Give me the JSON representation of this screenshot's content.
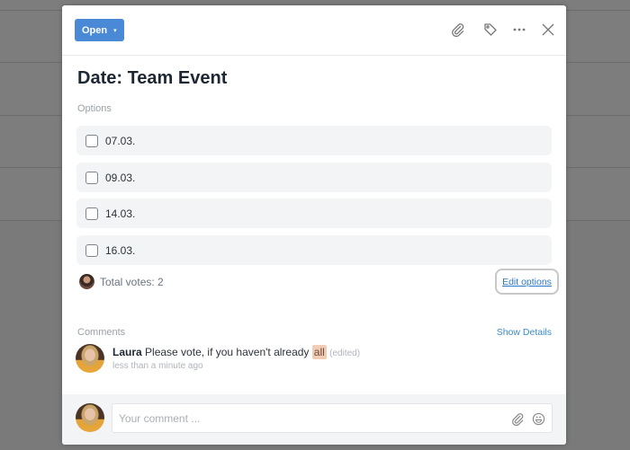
{
  "header": {
    "status_label": "Open",
    "status_caret": "▾",
    "status_color": "#4a89d6",
    "actions": [
      {
        "name": "attachment-icon"
      },
      {
        "name": "tag-icon"
      },
      {
        "name": "more-icon"
      },
      {
        "name": "close-icon"
      }
    ]
  },
  "title": "Date: Team Event",
  "poll": {
    "options_label": "Options",
    "options": [
      {
        "label": "07.03.",
        "checked": false
      },
      {
        "label": "09.03.",
        "checked": false
      },
      {
        "label": "14.03.",
        "checked": false
      },
      {
        "label": "16.03.",
        "checked": false
      }
    ],
    "total_votes_text": "Total votes: 2",
    "edit_options_label": "Edit options"
  },
  "comments": {
    "label": "Comments",
    "show_details_label": "Show Details",
    "items": [
      {
        "author": "Laura",
        "text": "Please vote, if you haven't already",
        "mention": "all",
        "edited": "(edited)",
        "timestamp": "less than a minute ago"
      }
    ],
    "input_placeholder": "Your comment ...",
    "input_value": ""
  }
}
